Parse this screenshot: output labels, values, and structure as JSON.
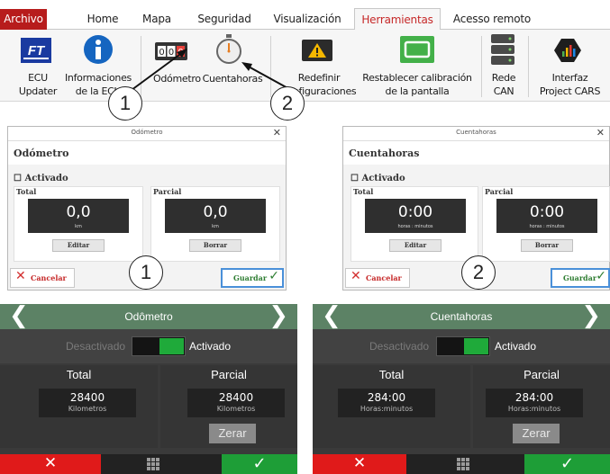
{
  "ribbon": {
    "tabs": [
      {
        "label": "Archivo"
      },
      {
        "label": "Home"
      },
      {
        "label": "Mapa"
      },
      {
        "label": "Seguridad"
      },
      {
        "label": "Visualización"
      },
      {
        "label": "Herramientas"
      },
      {
        "label": "Acesso remoto"
      }
    ],
    "active_tab": "Herramientas",
    "items": [
      {
        "label": "ECU\nUpdater",
        "icon": "ft-logo-icon"
      },
      {
        "label": "Informaciones\nde la ECU",
        "icon": "info-icon"
      },
      {
        "label": "Odómetro",
        "icon": "odometer-icon"
      },
      {
        "label": "Cuentahoras",
        "icon": "stopwatch-icon"
      },
      {
        "label": "Redefinir\nconfiguraciones",
        "icon": "warning-icon"
      },
      {
        "label": "Restablecer calibración\nde la pantalla",
        "icon": "screen-icon"
      },
      {
        "label": "Rede\nCAN",
        "icon": "server-icon"
      },
      {
        "label": "Interfaz\nProject CARS",
        "icon": "project-cars-icon"
      }
    ],
    "odometer_digits": "000",
    "callouts": [
      "1",
      "2"
    ]
  },
  "dialog_odometro": {
    "window_title": "Odómetro",
    "header": "Odómetro",
    "checkbox": "Activado",
    "total": {
      "label": "Total",
      "value": "0,0",
      "unit": "km",
      "button": "Editar"
    },
    "parcial": {
      "label": "Parcial",
      "value": "0,0",
      "unit": "km",
      "button": "Borrar"
    },
    "cancel": "Cancelar",
    "save": "Guardar",
    "callout": "1"
  },
  "dialog_cuentahoras": {
    "window_title": "Cuentahoras",
    "header": "Cuentahoras",
    "checkbox": "Activado",
    "total": {
      "label": "Total",
      "value": "0:00",
      "unit": "horas : minutos",
      "button": "Editar"
    },
    "parcial": {
      "label": "Parcial",
      "value": "0:00",
      "unit": "horas : minutos",
      "button": "Borrar"
    },
    "cancel": "Cancelar",
    "save": "Guardar",
    "callout": "2"
  },
  "device_odometro": {
    "title": "Odômetro",
    "off": "Desactivado",
    "on": "Activado",
    "total": {
      "label": "Total",
      "value": "28400",
      "unit": "Kilometros"
    },
    "parcial": {
      "label": "Parcial",
      "value": "28400",
      "unit": "Kilometros",
      "button": "Zerar"
    }
  },
  "device_cuentahoras": {
    "title": "Cuentahoras",
    "off": "Desactivado",
    "on": "Activado",
    "total": {
      "label": "Total",
      "value": "284:00",
      "unit": "Horas:minutos"
    },
    "parcial": {
      "label": "Parcial",
      "value": "284:00",
      "unit": "Horas:minutos",
      "button": "Zerar"
    }
  },
  "glyphs": {
    "x": "✕",
    "check": "✓",
    "left": "❮",
    "right": "❯",
    "close": "✕",
    "checkbox": "☐"
  },
  "colors": {
    "file_tab": "#b71c1c",
    "active_tab_text": "#c62828",
    "device_header": "#5c8265",
    "device_ok": "#1e9e37",
    "device_cancel": "#e01a1a"
  }
}
